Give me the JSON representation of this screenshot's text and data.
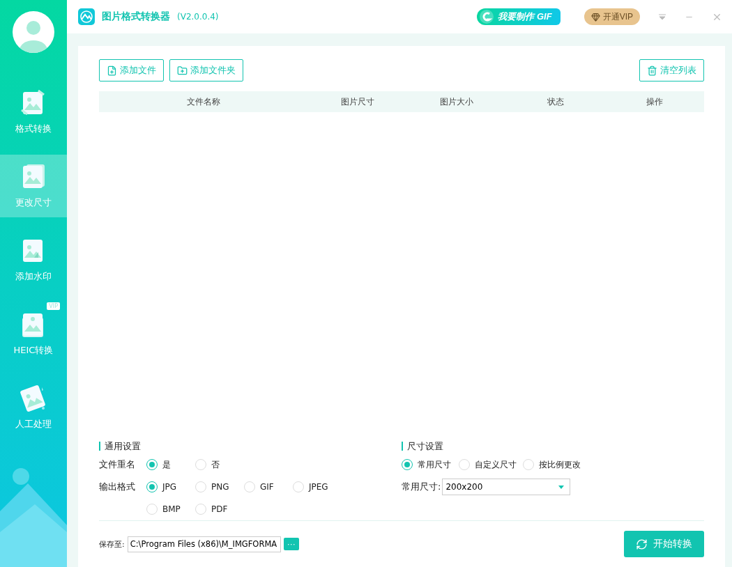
{
  "app": {
    "title": "图片格式转换器",
    "version": "(V2.0.0.4)"
  },
  "header": {
    "gif_button": "我要制作 GIF",
    "vip_button": "开通VIP"
  },
  "sidebar": {
    "items": [
      {
        "label": "格式转换",
        "kind": "convert",
        "selected": false
      },
      {
        "label": "更改尺寸",
        "kind": "resize",
        "selected": true
      },
      {
        "label": "添加水印",
        "kind": "watermark",
        "selected": false
      },
      {
        "label": "HEIC转换",
        "kind": "heic",
        "selected": false,
        "badge": "VIP"
      },
      {
        "label": "人工处理",
        "kind": "manual",
        "selected": false
      }
    ]
  },
  "toolbar": {
    "add_file": "添加文件",
    "add_folder": "添加文件夹",
    "clear_list": "清空列表"
  },
  "table": {
    "columns": [
      "文件名称",
      "图片尺寸",
      "图片大小",
      "状态",
      "操作"
    ]
  },
  "general_settings": {
    "title": "通用设置",
    "rename": {
      "label": "文件重名",
      "options": [
        {
          "label": "是",
          "selected": true
        },
        {
          "label": "否",
          "selected": false
        }
      ]
    },
    "format": {
      "label": "输出格式",
      "options": [
        {
          "label": "JPG",
          "selected": true
        },
        {
          "label": "PNG",
          "selected": false
        },
        {
          "label": "GIF",
          "selected": false
        },
        {
          "label": "JPEG",
          "selected": false
        },
        {
          "label": "BMP",
          "selected": false
        },
        {
          "label": "PDF",
          "selected": false
        }
      ]
    }
  },
  "size_settings": {
    "title": "尺寸设置",
    "modes": [
      {
        "label": "常用尺寸",
        "selected": true
      },
      {
        "label": "自定义尺寸",
        "selected": false
      },
      {
        "label": "按比例更改",
        "selected": false
      }
    ],
    "common_size": {
      "label": "常用尺寸:",
      "value": "200x200"
    }
  },
  "save": {
    "label": "保存至:",
    "path": "C:\\Program Files (x86)\\M_IMGFORMA",
    "browse": "···"
  },
  "start_button": "开始转换"
}
